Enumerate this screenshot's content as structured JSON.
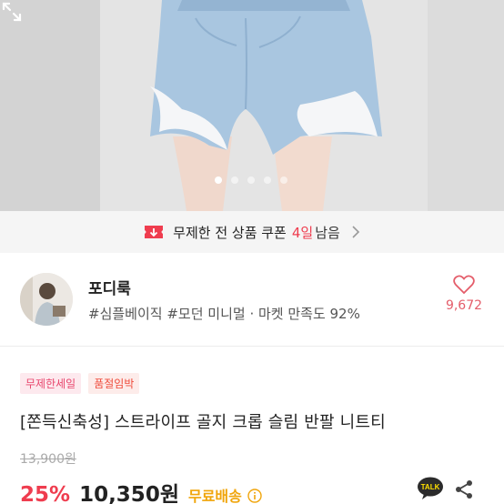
{
  "hero": {
    "image_description_icon": "product-photo",
    "carousel_count": 5,
    "carousel_active": 1,
    "expand_icon": "expand-icon"
  },
  "coupon": {
    "text": "무제한 전 상품 쿠폰",
    "days": "4일",
    "remain": "남음"
  },
  "shop": {
    "name": "포디룩",
    "tags": "#심플베이직 #모던 미니멀 · 마켓 만족도 92%",
    "like_count": "9,672"
  },
  "product": {
    "badges": [
      "무제한세일",
      "품절임박"
    ],
    "title": "[쫀득신축성] 스트라이프 골지 크롭 슬림 반팔 니트티",
    "original_price": "13,900원",
    "discount": "25%",
    "price": "10,350원",
    "shipping": "무료배송"
  },
  "colors": {
    "accent_red": "#ef3d4f",
    "shipping_orange": "#f0a50b",
    "like_pink": "#e45d6a"
  }
}
